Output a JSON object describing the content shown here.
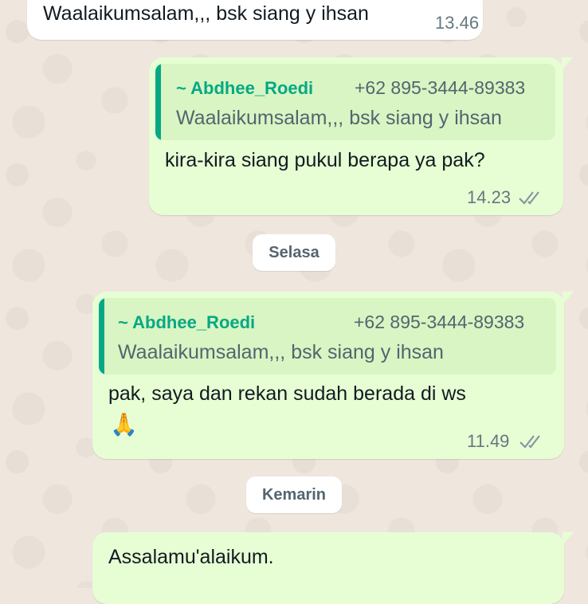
{
  "messages": [
    {
      "text": "Waalaikumsalam,,, bsk siang y ihsan",
      "time": "13.46"
    },
    {
      "quote": {
        "name": "~ Abdhee_Roedi",
        "phone": "+62 895-3444-89383",
        "text": "Waalaikumsalam,,, bsk siang y ihsan"
      },
      "text": "kira-kira siang pukul berapa ya pak?",
      "time": "14.23",
      "status_icon": "double-check-icon"
    },
    {
      "quote": {
        "name": "~ Abdhee_Roedi",
        "phone": "+62 895-3444-89383",
        "text": "Waalaikumsalam,,, bsk siang y ihsan"
      },
      "text": "pak, saya dan rekan sudah berada di ws",
      "emoji": "🙏",
      "time": "11.49",
      "status_icon": "double-check-icon"
    },
    {
      "text": "Assalamu'alaikum."
    }
  ],
  "date_separators": [
    "Selasa",
    "Kemarin"
  ],
  "colors": {
    "outgoing_bubble": "#e7fed4",
    "incoming_bubble": "#ffffff",
    "quote_accent": "#06a884",
    "tick_gray": "#8696a0"
  }
}
